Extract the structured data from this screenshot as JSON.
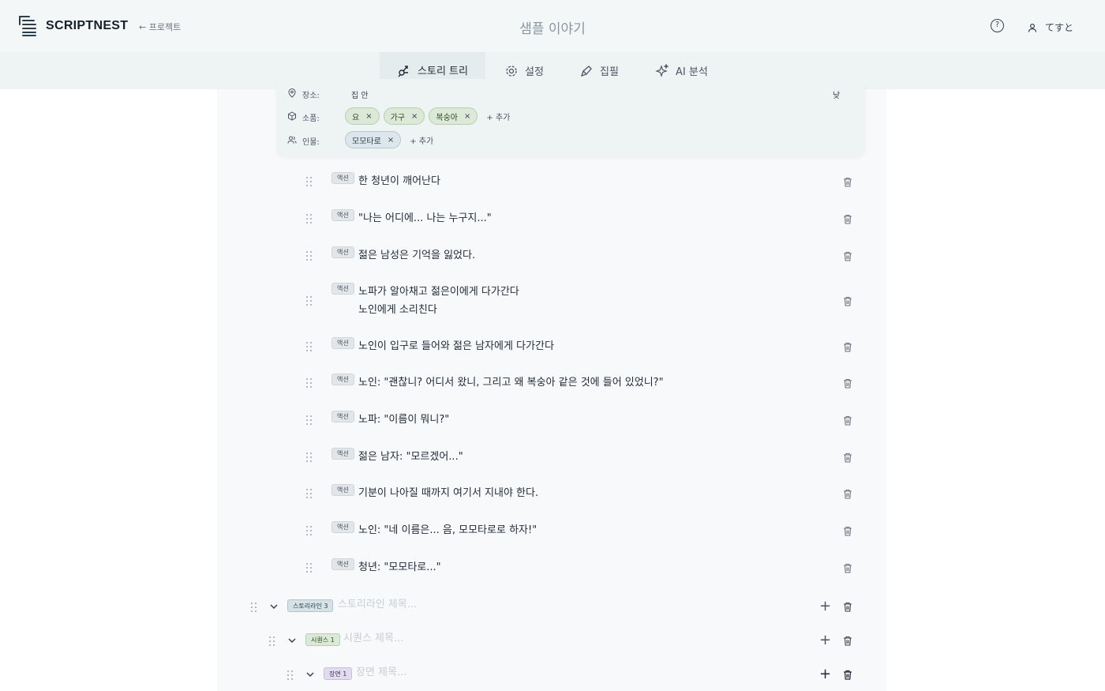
{
  "app": {
    "name": "SCRIPTNEST",
    "back_label": "← 프로젝트",
    "story_title": "샘플 이야기",
    "user_name": "てすと",
    "help_glyph": "?"
  },
  "tabs": [
    {
      "label": "스토리 트리",
      "icon": "story-tree-icon",
      "active": true
    },
    {
      "label": "설정",
      "icon": "gear-icon",
      "active": false
    },
    {
      "label": "집필",
      "icon": "pen-icon",
      "active": false
    },
    {
      "label": "AI 분석",
      "icon": "sparkle-icon",
      "active": false
    }
  ],
  "scene_meta": {
    "location_label": "장소:",
    "location_value": "집 안",
    "time_value": "낮",
    "props_label": "소품:",
    "props": [
      "요",
      "가구",
      "복숭아"
    ],
    "characters_label": "인물:",
    "characters": [
      "모모타로"
    ],
    "add_label": "+ 추가",
    "remove_glyph": "×"
  },
  "lines": [
    {
      "type": "액션",
      "text": "한 청년이 깨어난다"
    },
    {
      "type": "액션",
      "text": "\"나는 어디에... 나는 누구지...\""
    },
    {
      "type": "액션",
      "text": "젊은 남성은 기억을 잃었다."
    },
    {
      "type": "액션",
      "text": "노파가 알아채고 젊은이에게 다가간다",
      "text2": "노인에게 소리친다"
    },
    {
      "type": "액션",
      "text": "노인이 입구로 들어와 젊은 남자에게 다가간다"
    },
    {
      "type": "액션",
      "text": "노인: \"괜찮니? 어디서 왔니, 그리고 왜 복숭아 같은 것에 들어 있었니?\""
    },
    {
      "type": "액션",
      "text": "노파: \"이름이 뭐니?\""
    },
    {
      "type": "액션",
      "text": "젊은 남자: \"모르겠어...\""
    },
    {
      "type": "액션",
      "text": "기분이 나아질 때까지 여기서 지내야 한다."
    },
    {
      "type": "액션",
      "text": "노인: \"네 이름은... 음, 모모타로로 하자!\""
    },
    {
      "type": "액션",
      "text": "청년: \"모모타로...\""
    }
  ],
  "tree": {
    "storyline": {
      "badge": "스토리라인 3",
      "placeholder": "스토리라인 제목..."
    },
    "sequence": {
      "badge": "시퀀스 1",
      "placeholder": "시퀀스 제목..."
    },
    "scene": {
      "badge": "장면 1",
      "placeholder": "장면 제목..."
    },
    "add_glyph": "+"
  },
  "colors": {
    "header_bg": "#f4f7f7",
    "tab_bg": "#eef3f4",
    "content_bg": "#f7f9fa",
    "prop_chip": "#dbe9d6",
    "char_chip": "#dde6ea",
    "scene_badge": "#e2dcef"
  }
}
